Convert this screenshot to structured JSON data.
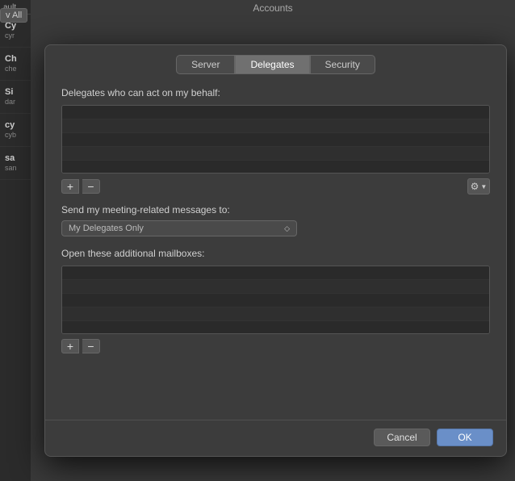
{
  "title": "Accounts",
  "view_all_label": "v All",
  "tabs": [
    {
      "id": "server",
      "label": "Server",
      "active": false
    },
    {
      "id": "delegates",
      "label": "Delegates",
      "active": true
    },
    {
      "id": "security",
      "label": "Security",
      "active": false
    }
  ],
  "delegates_section": {
    "label": "Delegates who can act on my behalf:",
    "rows": 5
  },
  "add_button_label": "+",
  "remove_button_label": "−",
  "gear_icon": "⚙",
  "chevron_icon": "▼",
  "meeting_section": {
    "label": "Send my meeting-related messages to:",
    "select_value": "My Delegates Only",
    "chevron": "◇"
  },
  "mailboxes_section": {
    "label": "Open these additional mailboxes:",
    "rows": 5
  },
  "footer": {
    "cancel_label": "Cancel",
    "ok_label": "OK"
  },
  "sidebar": {
    "items": [
      {
        "initials": "Cy",
        "sub": "cyr"
      },
      {
        "initials": "Ch",
        "sub": "che"
      },
      {
        "initials": "Si",
        "sub": "dar"
      },
      {
        "initials": "cy",
        "sub": "cyb"
      },
      {
        "initials": "sa",
        "sub": "san"
      }
    ]
  }
}
